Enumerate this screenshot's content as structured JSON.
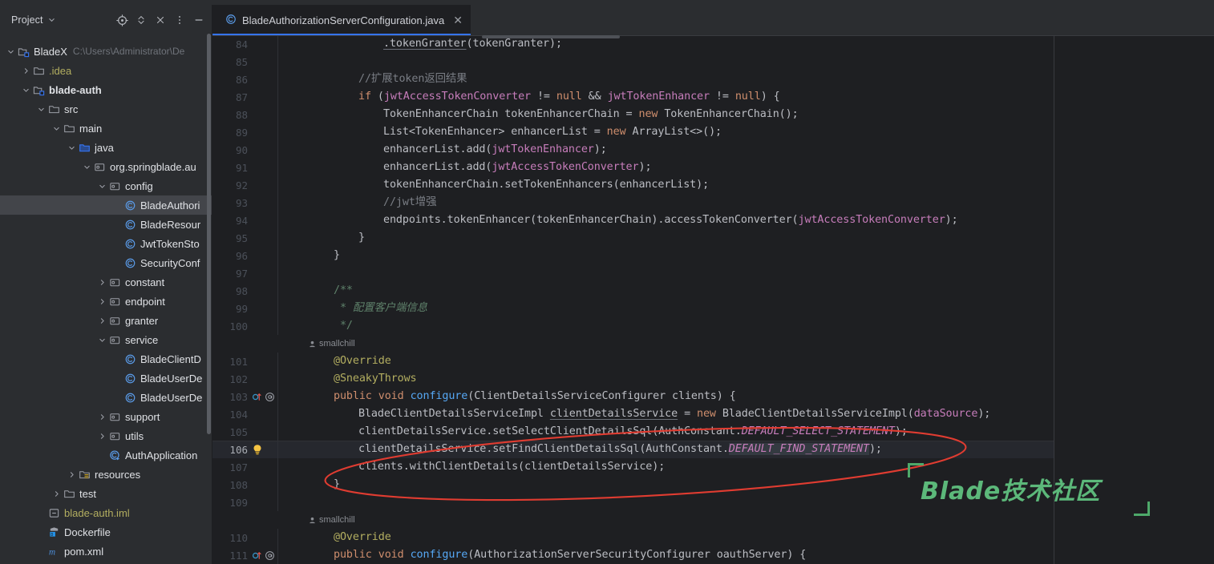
{
  "window": {
    "top_strip_color": "#2B2D30"
  },
  "project_panel": {
    "title": "Project",
    "title_chevron_icon": "chevron-down-icon",
    "toolbar": [
      {
        "name": "select-opened-file-icon",
        "label": "locate"
      },
      {
        "name": "expand-collapse-icon",
        "label": "expand"
      },
      {
        "name": "collapse-all-icon",
        "label": "collapse-all"
      },
      {
        "name": "more-options-icon",
        "label": "options"
      },
      {
        "name": "hide-panel-icon",
        "label": "hide"
      }
    ],
    "tree": [
      {
        "indent": 0,
        "twisty": "down",
        "icon": "module-icon",
        "label": "BladeX",
        "sub": "C:\\Users\\Administrator\\De",
        "style": "plain",
        "selected": false
      },
      {
        "indent": 1,
        "twisty": "right",
        "icon": "folder-icon",
        "label": ".idea",
        "sub": "",
        "style": "yellow",
        "selected": false
      },
      {
        "indent": 1,
        "twisty": "down",
        "icon": "module-icon",
        "label": "blade-auth",
        "sub": "",
        "style": "bold",
        "selected": false
      },
      {
        "indent": 2,
        "twisty": "down",
        "icon": "folder-icon",
        "label": "src",
        "sub": "",
        "style": "plain",
        "selected": false
      },
      {
        "indent": 3,
        "twisty": "down",
        "icon": "folder-icon",
        "label": "main",
        "sub": "",
        "style": "plain",
        "selected": false
      },
      {
        "indent": 4,
        "twisty": "down",
        "icon": "source-folder-icon",
        "label": "java",
        "sub": "",
        "style": "plain",
        "selected": false
      },
      {
        "indent": 5,
        "twisty": "down",
        "icon": "package-icon",
        "label": "org.springblade.au",
        "sub": "",
        "style": "plain",
        "selected": false
      },
      {
        "indent": 6,
        "twisty": "down",
        "icon": "package-icon",
        "label": "config",
        "sub": "",
        "style": "plain",
        "selected": false
      },
      {
        "indent": 7,
        "twisty": "none",
        "icon": "class-icon",
        "label": "BladeAuthori",
        "sub": "",
        "style": "plain",
        "selected": true
      },
      {
        "indent": 7,
        "twisty": "none",
        "icon": "class-icon",
        "label": "BladeResour",
        "sub": "",
        "style": "plain",
        "selected": false
      },
      {
        "indent": 7,
        "twisty": "none",
        "icon": "class-icon",
        "label": "JwtTokenSto",
        "sub": "",
        "style": "plain",
        "selected": false
      },
      {
        "indent": 7,
        "twisty": "none",
        "icon": "class-icon",
        "label": "SecurityConf",
        "sub": "",
        "style": "plain",
        "selected": false
      },
      {
        "indent": 6,
        "twisty": "right",
        "icon": "package-icon",
        "label": "constant",
        "sub": "",
        "style": "plain",
        "selected": false
      },
      {
        "indent": 6,
        "twisty": "right",
        "icon": "package-icon",
        "label": "endpoint",
        "sub": "",
        "style": "plain",
        "selected": false
      },
      {
        "indent": 6,
        "twisty": "right",
        "icon": "package-icon",
        "label": "granter",
        "sub": "",
        "style": "plain",
        "selected": false
      },
      {
        "indent": 6,
        "twisty": "down",
        "icon": "package-icon",
        "label": "service",
        "sub": "",
        "style": "plain",
        "selected": false
      },
      {
        "indent": 7,
        "twisty": "none",
        "icon": "class-icon",
        "label": "BladeClientD",
        "sub": "",
        "style": "plain",
        "selected": false
      },
      {
        "indent": 7,
        "twisty": "none",
        "icon": "class-icon",
        "label": "BladeUserDe",
        "sub": "",
        "style": "plain",
        "selected": false
      },
      {
        "indent": 7,
        "twisty": "none",
        "icon": "class-icon",
        "label": "BladeUserDe",
        "sub": "",
        "style": "plain",
        "selected": false
      },
      {
        "indent": 6,
        "twisty": "right",
        "icon": "package-icon",
        "label": "support",
        "sub": "",
        "style": "plain",
        "selected": false
      },
      {
        "indent": 6,
        "twisty": "right",
        "icon": "package-icon",
        "label": "utils",
        "sub": "",
        "style": "plain",
        "selected": false
      },
      {
        "indent": 6,
        "twisty": "none",
        "icon": "runnable-class-icon",
        "label": "AuthApplication",
        "sub": "",
        "style": "plain",
        "selected": false
      },
      {
        "indent": 4,
        "twisty": "right",
        "icon": "resources-folder-icon",
        "label": "resources",
        "sub": "",
        "style": "plain",
        "selected": false
      },
      {
        "indent": 3,
        "twisty": "right",
        "icon": "folder-icon",
        "label": "test",
        "sub": "",
        "style": "plain",
        "selected": false
      },
      {
        "indent": 2,
        "twisty": "none",
        "icon": "iml-file-icon",
        "label": "blade-auth.iml",
        "sub": "",
        "style": "yellow",
        "selected": false
      },
      {
        "indent": 2,
        "twisty": "none",
        "icon": "docker-file-icon",
        "label": "Dockerfile",
        "sub": "",
        "style": "plain",
        "selected": false
      },
      {
        "indent": 2,
        "twisty": "none",
        "icon": "maven-file-icon",
        "label": "pom.xml",
        "sub": "",
        "style": "plain",
        "selected": false
      }
    ]
  },
  "editor": {
    "tab": {
      "icon": "java-class-icon",
      "label": "BladeAuthorizationServerConfiguration.java",
      "close_icon": "close-icon",
      "active_underline_color": "#3574F0"
    },
    "current_line": 106,
    "lines": [
      {
        "num": 84,
        "indent": 3,
        "html": "<span class=\"udl\">.tokenGranter</span>(tokenGranter);"
      },
      {
        "num": 85,
        "indent": 0,
        "html": ""
      },
      {
        "num": 86,
        "indent": 2,
        "html": "<span class=\"cmt\">//扩展token返回结果</span>"
      },
      {
        "num": 87,
        "indent": 2,
        "html": "<span class=\"k\">if</span> (<span class=\"fld\">jwtAccessTokenConverter</span> != <span class=\"k\">null</span> &amp;&amp; <span class=\"fld\">jwtTokenEnhancer</span> != <span class=\"k\">null</span>) {"
      },
      {
        "num": 88,
        "indent": 3,
        "html": "TokenEnhancerChain tokenEnhancerChain = <span class=\"k\">new</span> TokenEnhancerChain();"
      },
      {
        "num": 89,
        "indent": 3,
        "html": "List&lt;TokenEnhancer&gt; enhancerList = <span class=\"k\">new</span> ArrayList&lt;&gt;();"
      },
      {
        "num": 90,
        "indent": 3,
        "html": "enhancerList.add(<span class=\"fld\">jwtTokenEnhancer</span>);"
      },
      {
        "num": 91,
        "indent": 3,
        "html": "enhancerList.add(<span class=\"fld\">jwtAccessTokenConverter</span>);"
      },
      {
        "num": 92,
        "indent": 3,
        "html": "tokenEnhancerChain.setTokenEnhancers(enhancerList);"
      },
      {
        "num": 93,
        "indent": 3,
        "html": "<span class=\"cmt\">//jwt增强</span>"
      },
      {
        "num": 94,
        "indent": 3,
        "html": "endpoints.tokenEnhancer(tokenEnhancerChain).accessTokenConverter(<span class=\"fld\">jwtAccessTokenConverter</span>);"
      },
      {
        "num": 95,
        "indent": 2,
        "html": "}"
      },
      {
        "num": 96,
        "indent": 1,
        "html": "}"
      },
      {
        "num": 97,
        "indent": 0,
        "html": ""
      },
      {
        "num": 98,
        "indent": 1,
        "html": "<span class=\"docp\">/**</span>"
      },
      {
        "num": 99,
        "indent": 1,
        "html": " <span class=\"docp\">*</span> <span class=\"doc\">配置客户端信息</span>"
      },
      {
        "num": 100,
        "indent": 1,
        "html": " <span class=\"docp\">*/</span>"
      },
      {
        "num": null,
        "blame": "smallchill"
      },
      {
        "num": 101,
        "indent": 1,
        "html": "<span class=\"ann\">@Override</span>"
      },
      {
        "num": 102,
        "indent": 1,
        "html": "<span class=\"ann\">@SneakyThrows</span>"
      },
      {
        "num": 103,
        "indent": 1,
        "gutter_icons": [
          "override-method-icon",
          "annotation-gutter-icon"
        ],
        "html": "<span class=\"k\">public</span> <span class=\"k\">void</span> <span class=\"mth\">configure</span>(ClientDetailsServiceConfigurer clients) {"
      },
      {
        "num": 104,
        "indent": 2,
        "html": "BladeClientDetailsServiceImpl <span class=\"udl\">clientDetailsService</span> = <span class=\"k\">new</span> BladeClientDetailsServiceImpl(<span class=\"fld\">dataSource</span>);"
      },
      {
        "num": 105,
        "indent": 2,
        "html": "clientDetailsService.setSelectClientDetailsSql(AuthConstant.<span class=\"cst\">DEFAULT_SELECT_STATEMENT</span>);"
      },
      {
        "num": 106,
        "indent": 2,
        "gutter_icons": [
          "intention-bulb-icon"
        ],
        "html": "clientDetailsService.setFindClientDetailsSql(AuthConstant.<span class=\"cst cst-hl\">DEFAULT_FIND_STATEMENT</span>);"
      },
      {
        "num": 107,
        "indent": 2,
        "html": "clients.withClientDetails(clientDetailsService);"
      },
      {
        "num": 108,
        "indent": 1,
        "html": "}"
      },
      {
        "num": 109,
        "indent": 0,
        "html": ""
      },
      {
        "num": null,
        "blame": "smallchill"
      },
      {
        "num": 110,
        "indent": 1,
        "html": "<span class=\"ann\">@Override</span>"
      },
      {
        "num": 111,
        "indent": 1,
        "gutter_icons": [
          "override-method-icon",
          "annotation-gutter-icon"
        ],
        "html": "<span class=\"k\">public</span> <span class=\"k\">void</span> <span class=\"mth\">configure</span>(AuthorizationServerSecurityConfigurer oauthServer) {"
      }
    ]
  },
  "annotations": {
    "ellipse": {
      "name": "red-ellipse-highlight",
      "color": "#E03C31",
      "covers_lines": [
        105,
        106
      ]
    }
  },
  "watermark": {
    "text": "Blade技术社区",
    "color": "#5CB87A",
    "bracket_color": "#4EA96A"
  },
  "colors": {
    "background": "#1E1F22",
    "panel": "#2B2D30",
    "selection": "#43454A",
    "current_line": "#26282E",
    "accent": "#3574F0",
    "keyword": "#CF8E6D",
    "field": "#C77DBB",
    "comment": "#7A7E85",
    "javadoc": "#5F826B",
    "annotation": "#B3AE60",
    "method": "#56A8F5",
    "text": "#BCBEC4",
    "line_number": "#4B5059"
  }
}
